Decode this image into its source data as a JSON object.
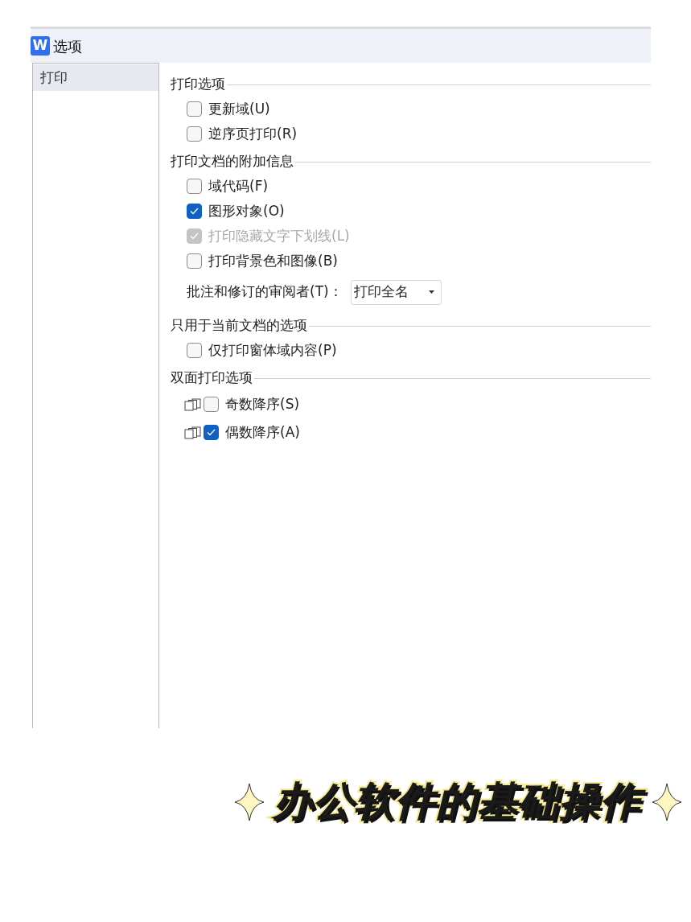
{
  "window": {
    "app_icon": "W",
    "title": "选项"
  },
  "sidebar": {
    "items": [
      {
        "label": "打印",
        "selected": true
      }
    ]
  },
  "sections": [
    {
      "title": "打印选项",
      "items": [
        {
          "kind": "checkbox",
          "label": "更新域(U)",
          "checked": false,
          "disabled": false
        },
        {
          "kind": "checkbox",
          "label": "逆序页打印(R)",
          "checked": false,
          "disabled": false
        }
      ]
    },
    {
      "title": "打印文档的附加信息",
      "items": [
        {
          "kind": "checkbox",
          "label": "域代码(F)",
          "checked": false,
          "disabled": false
        },
        {
          "kind": "checkbox",
          "label": "图形对象(O)",
          "checked": true,
          "disabled": false
        },
        {
          "kind": "checkbox",
          "label": "打印隐藏文字下划线(L)",
          "checked": true,
          "disabled": true
        },
        {
          "kind": "checkbox",
          "label": "打印背景色和图像(B)",
          "checked": false,
          "disabled": false
        },
        {
          "kind": "dropdown",
          "label": "批注和修订的审阅者(T)：",
          "value": "打印全名"
        }
      ]
    },
    {
      "title": "只用于当前文档的选项",
      "items": [
        {
          "kind": "checkbox",
          "label": "仅打印窗体域内容(P)",
          "checked": false,
          "disabled": false
        }
      ]
    },
    {
      "title": "双面打印选项",
      "items": [
        {
          "kind": "duplex",
          "label": "奇数降序(S)",
          "checked": false,
          "disabled": false
        },
        {
          "kind": "duplex",
          "label": "偶数降序(A)",
          "checked": true,
          "disabled": false
        }
      ]
    }
  ],
  "caption": "办公软件的基础操作"
}
